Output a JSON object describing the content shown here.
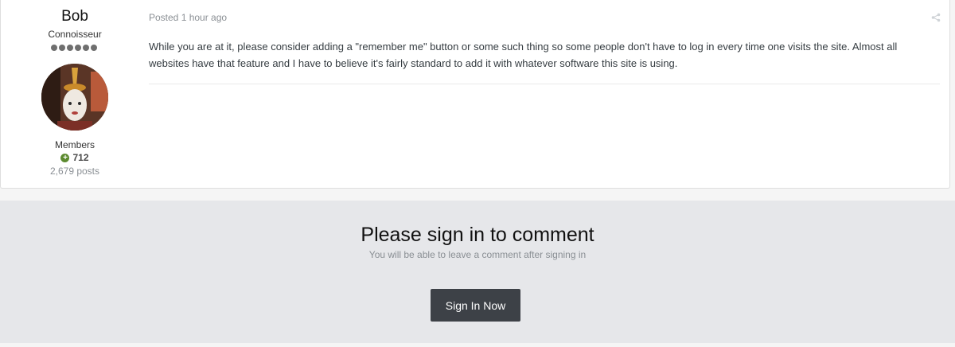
{
  "post": {
    "author": {
      "name": "Bob",
      "title": "Connoisseur",
      "rank_pips": 6,
      "group": "Members",
      "reputation": "712",
      "posts": "2,679 posts"
    },
    "meta": {
      "posted": "Posted 1 hour ago"
    },
    "body": "While you are at it, please consider adding a \"remember me\" button or some such thing so some people don't have to log in every time one visits the site.  Almost all websites have that feature and I have to believe it's fairly standard to add it with whatever software this site is using.",
    "icons": {
      "share": "share-icon",
      "reputation": "plus-circle-icon"
    }
  },
  "signin": {
    "title": "Please sign in to comment",
    "subtitle": "You will be able to leave a comment after signing in",
    "button_label": "Sign In Now"
  },
  "colors": {
    "reputation_green": "#5c8a2f",
    "button_bg": "#3d4147",
    "panel_bg": "#e6e7ea"
  }
}
